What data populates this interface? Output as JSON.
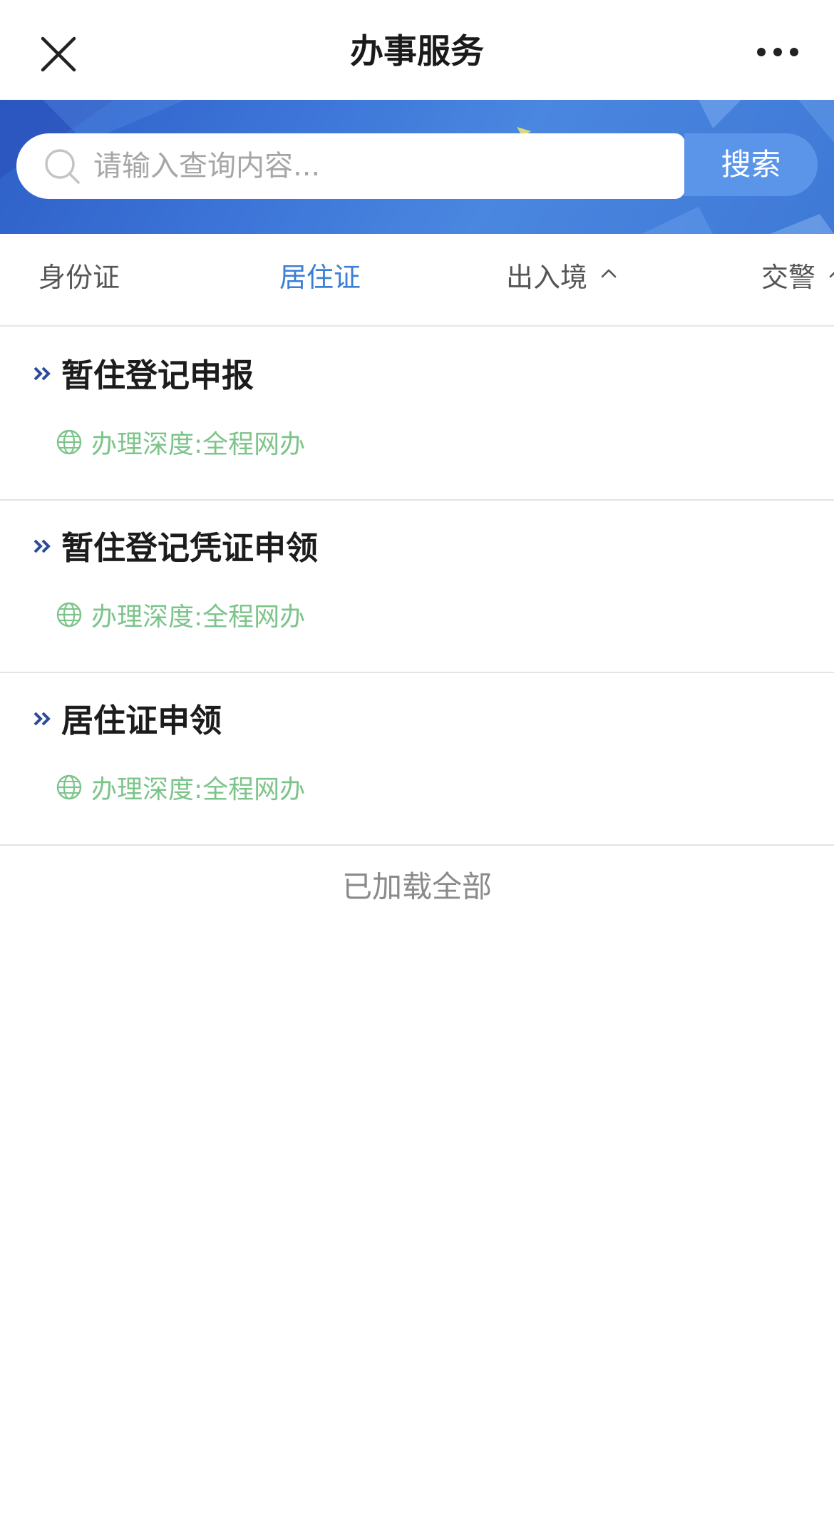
{
  "header": {
    "title": "办事服务",
    "close_icon": "close-icon",
    "more_icon": "more-dots-icon"
  },
  "search": {
    "placeholder": "请输入查询内容...",
    "value": "",
    "button_label": "搜索",
    "icon": "search-icon"
  },
  "tabs": [
    {
      "label": "身份证",
      "active": false
    },
    {
      "label": "居住证",
      "active": true
    },
    {
      "label": "出入境",
      "active": false,
      "icon": "chevron-up-icon"
    },
    {
      "label": "交警",
      "active": false,
      "icon": "chevron-up-icon"
    }
  ],
  "items": [
    {
      "title": "暂住登记申报",
      "meta_label": "办理深度:",
      "meta_value": "全程网办"
    },
    {
      "title": "暂住登记凭证申领",
      "meta_label": "办理深度:",
      "meta_value": "全程网办"
    },
    {
      "title": "居住证申领",
      "meta_label": "办理深度:",
      "meta_value": "全程网办"
    }
  ],
  "status_text": "已加载全部",
  "colors": {
    "accent": "#3b7fd6",
    "banner": "#3d76d8",
    "search_button": "#5b95ea",
    "meta_green": "#7cc48a"
  }
}
